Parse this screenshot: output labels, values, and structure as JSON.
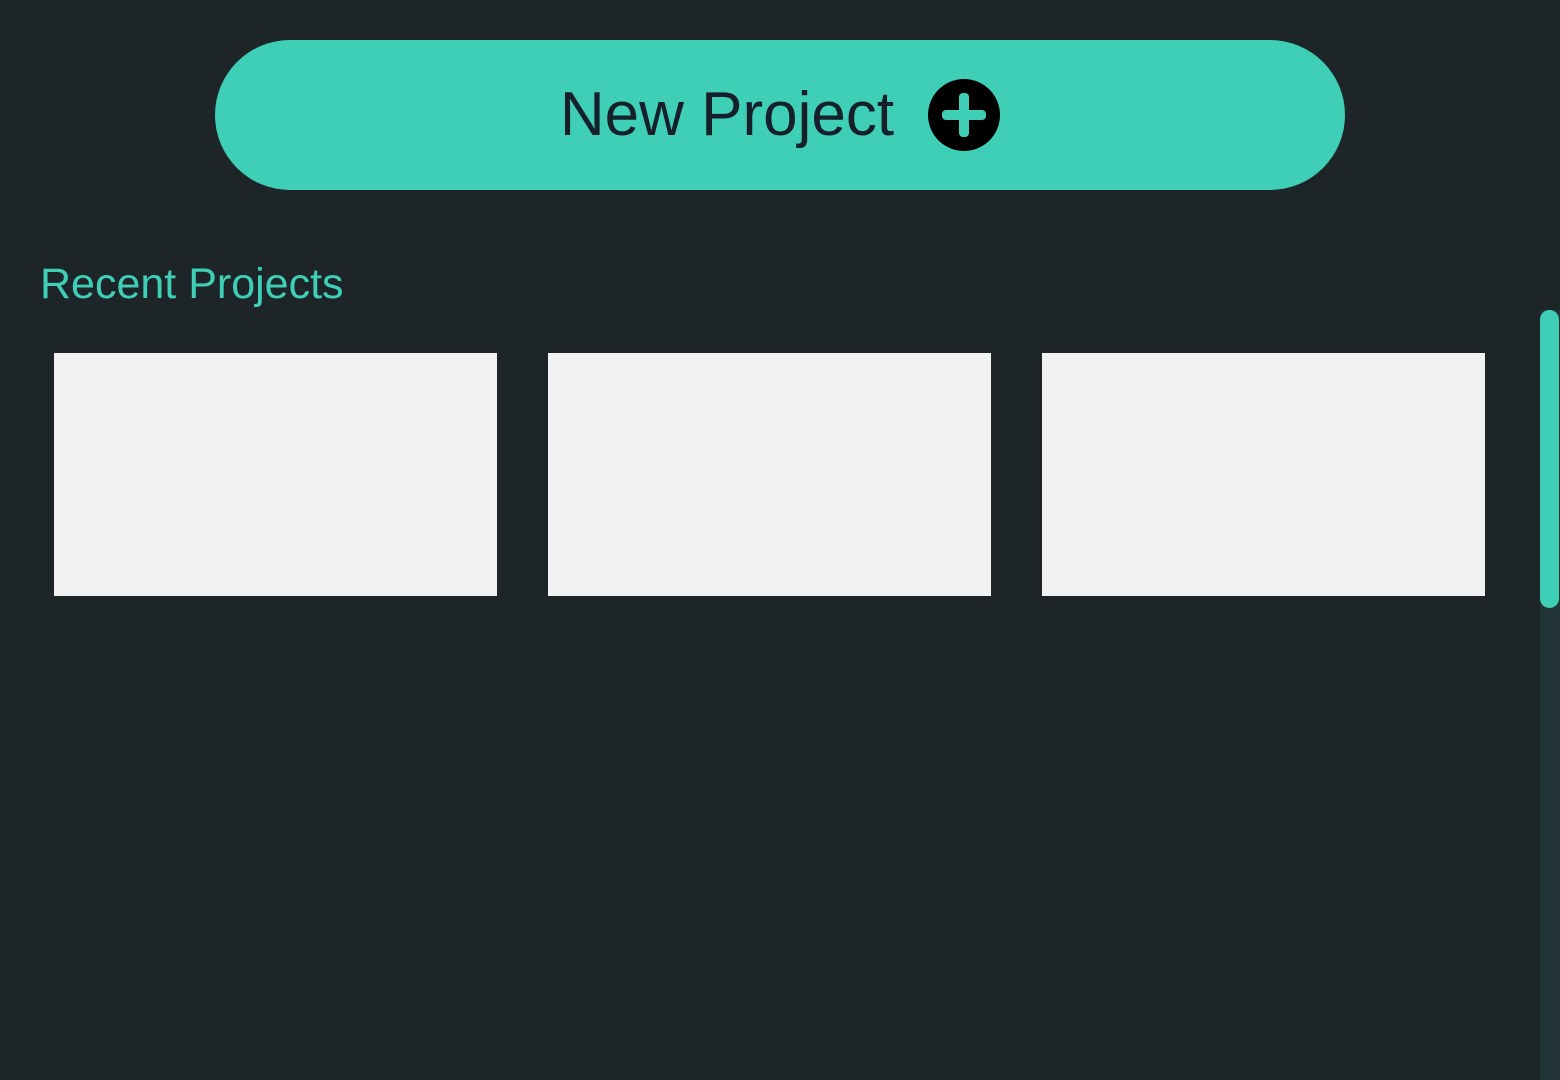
{
  "new_project_button": {
    "label": "New Project",
    "icon": "plus-circle-icon"
  },
  "recent_projects": {
    "title": "Recent Projects",
    "items": [
      {},
      {},
      {}
    ]
  },
  "colors": {
    "background": "#1e2529",
    "accent": "#3fcfb7",
    "button_text": "#15202a",
    "card": "#f2f2f2",
    "scroll_track": "#233436"
  }
}
